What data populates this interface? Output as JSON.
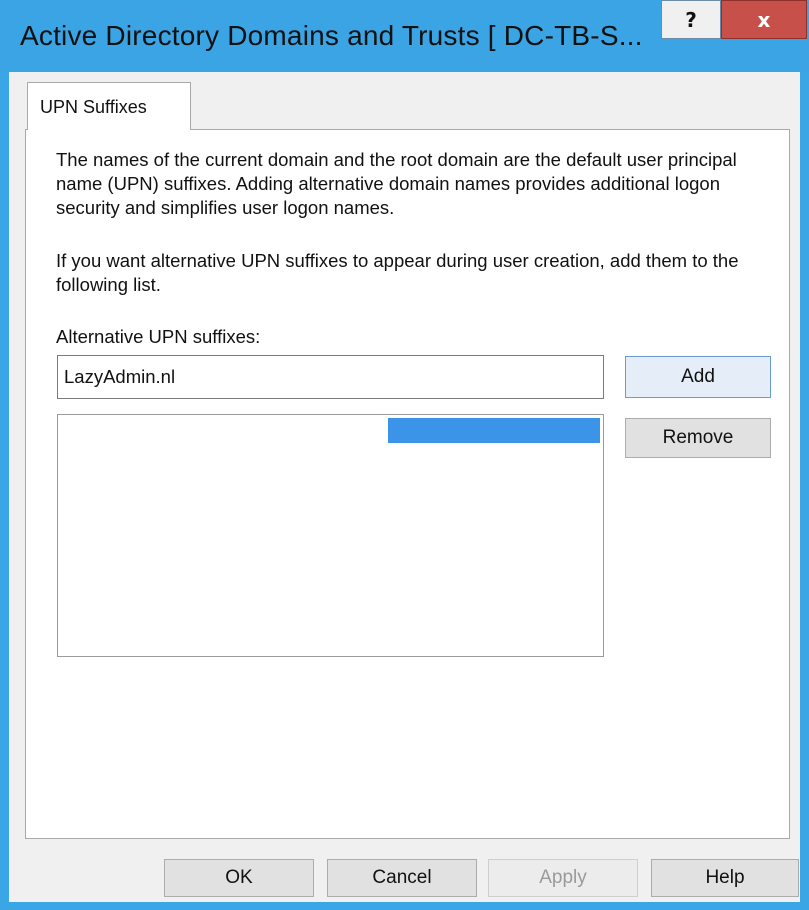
{
  "window": {
    "title": "Active Directory Domains and Trusts [ DC-TB-S...",
    "help_glyph": "?",
    "close_glyph": "x"
  },
  "tabs": [
    {
      "label": "UPN Suffixes"
    }
  ],
  "panel": {
    "description_1": "The names of the current domain and the root domain are the default user principal name (UPN) suffixes. Adding alternative domain names provides additional logon security and simplifies user logon names.",
    "description_2": "If you want alternative UPN suffixes to appear during user creation, add them to the following list.",
    "field_label": "Alternative UPN suffixes:",
    "input_value": "LazyAdmin.nl",
    "list_items": [],
    "add_label": "Add",
    "remove_label": "Remove"
  },
  "footer": {
    "ok_label": "OK",
    "cancel_label": "Cancel",
    "apply_label": "Apply",
    "help_label": "Help"
  },
  "colors": {
    "titlebar": "#3aa4e4",
    "close_button": "#c7514a",
    "selection": "#3c94e8"
  }
}
